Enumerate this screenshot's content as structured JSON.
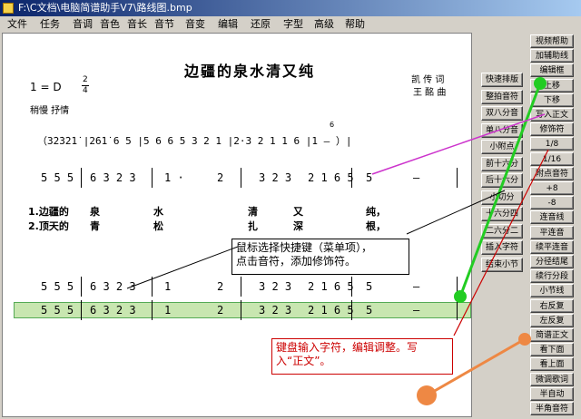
{
  "window": {
    "title": "F:\\C文档\\电脑简谱助手V7\\路线图.bmp"
  },
  "menu": [
    "文件",
    "任务",
    "音调",
    "音色",
    "音长",
    "音节",
    "音变",
    "编辑",
    "还原",
    "字型",
    "高级",
    "帮助"
  ],
  "score": {
    "title": "边疆的泉水清又纯",
    "key": "1 = D",
    "time_top": "2",
    "time_bottom": "4",
    "lyricist": "凯  传  词",
    "composer": "王  酩  曲",
    "tempo": "稍慢  抒情",
    "intro_line": "（3̇2̇3̇2̇1̇  |2̇6̇1̇  6 5  |5 6 6 5 3 2 1  |2·3 2 1  1 6  |1   —   ）|",
    "grace": "6",
    "row2": [
      "5 5 5",
      "6 3 2 3",
      "1 ·",
      "2",
      "3 2 3",
      "2 1 6 5",
      "5",
      "—"
    ],
    "lyric1": [
      "1.边疆的",
      "泉",
      "水",
      "清",
      "又",
      "纯，"
    ],
    "lyric2": [
      "2.顶天的",
      "青",
      "松",
      "扎",
      "深",
      "根，"
    ],
    "row3": [
      "5 5 5",
      "6 3 2 3",
      "1",
      "2",
      "3 2 3",
      "2 1 6 5",
      "5",
      "—"
    ],
    "row4": [
      "5 5 5",
      "6 3 2 3",
      "1",
      "2",
      "3 2 3",
      "2 1 6 5",
      "5",
      "—"
    ]
  },
  "callouts": {
    "mouse_line1": "鼠标选择快捷键（菜单项），",
    "mouse_line2": "点击音符，添加修饰符。",
    "kbd_line1": "键盘输入字符，编辑调整。写",
    "kbd_line2": "入“正文”。"
  },
  "panel_left": [
    "快速排版",
    "整拍音符",
    "双八分音",
    "单八分音",
    "小附点",
    "前十六分",
    "后十六分",
    "小切分",
    "十六分四",
    "二六分二",
    "插入字符",
    "结束小节"
  ],
  "panel_right": [
    "视频帮助",
    "加辅助线",
    "编辑框",
    "上移",
    "下移",
    "写入正文",
    "修饰符",
    "1/8",
    "1/16",
    "附点音符",
    "+8",
    "-8",
    "连音线",
    "平连音",
    "续平连音",
    "分径结尾",
    "续行分段",
    "小节线",
    "右反复",
    "左反复",
    "简谱正文",
    "看下面",
    "看上面",
    "微调歌词",
    "半自动",
    "半角音符"
  ],
  "colors": {
    "highlight": "#c8e6b0",
    "green": "#22cc22",
    "magenta": "#cc33cc",
    "orange": "#ee8844",
    "red_text": "#cc0000"
  }
}
